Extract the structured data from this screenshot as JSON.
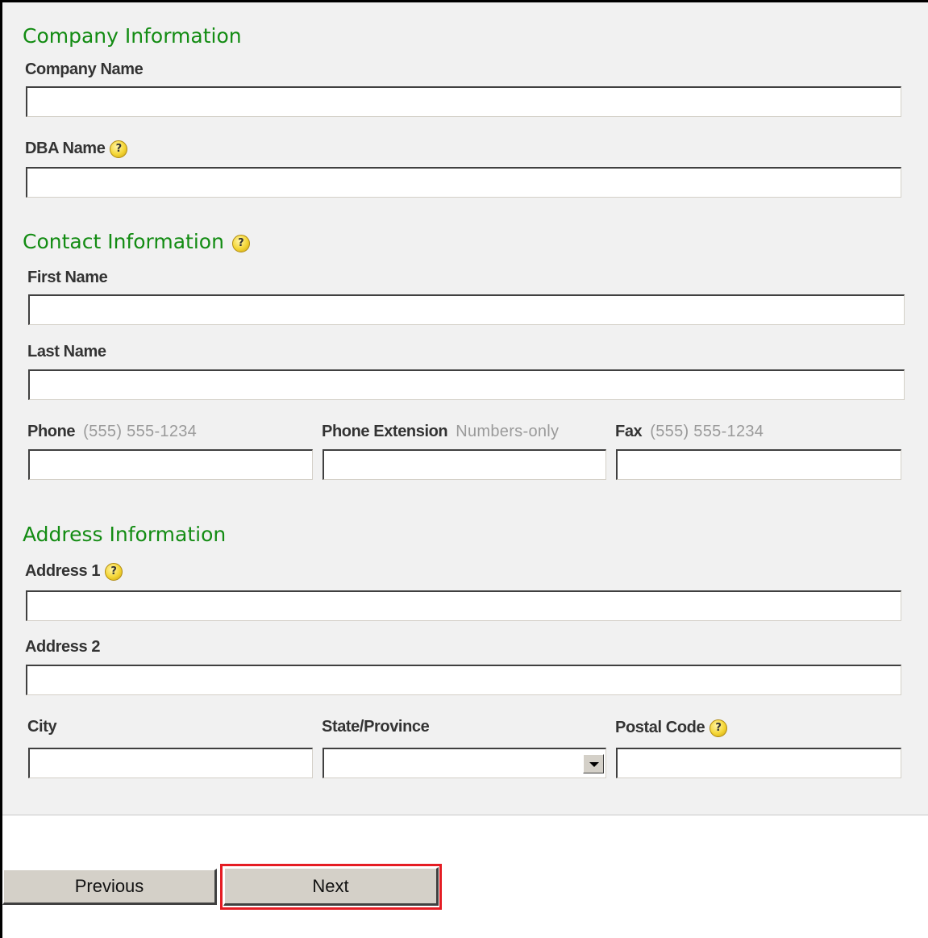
{
  "company_section": {
    "heading": "Company Information",
    "company_name_label": "Company Name",
    "company_name_value": "",
    "dba_name_label": "DBA Name",
    "dba_name_value": ""
  },
  "contact_section": {
    "heading": "Contact Information",
    "first_name_label": "First Name",
    "first_name_value": "",
    "last_name_label": "Last Name",
    "last_name_value": "",
    "phone_label": "Phone",
    "phone_hint": "(555) 555-1234",
    "phone_value": "",
    "phone_extension_label": "Phone Extension",
    "phone_extension_hint": "Numbers-only",
    "phone_extension_value": "",
    "fax_label": "Fax",
    "fax_hint": "(555) 555-1234",
    "fax_value": ""
  },
  "address_section": {
    "heading": "Address Information",
    "address1_label": "Address 1",
    "address1_value": "",
    "address2_label": "Address 2",
    "address2_value": "",
    "city_label": "City",
    "city_value": "",
    "state_label": "State/Province",
    "state_selected": "",
    "postal_code_label": "Postal Code",
    "postal_code_value": ""
  },
  "help_icon_glyph": "?",
  "navigation": {
    "previous_label": "Previous",
    "next_label": "Next"
  },
  "colors": {
    "heading_green": "#138c13",
    "panel_background": "#f1f1f1",
    "focus_red": "#e51c23",
    "button_face": "#d4d0c8"
  }
}
